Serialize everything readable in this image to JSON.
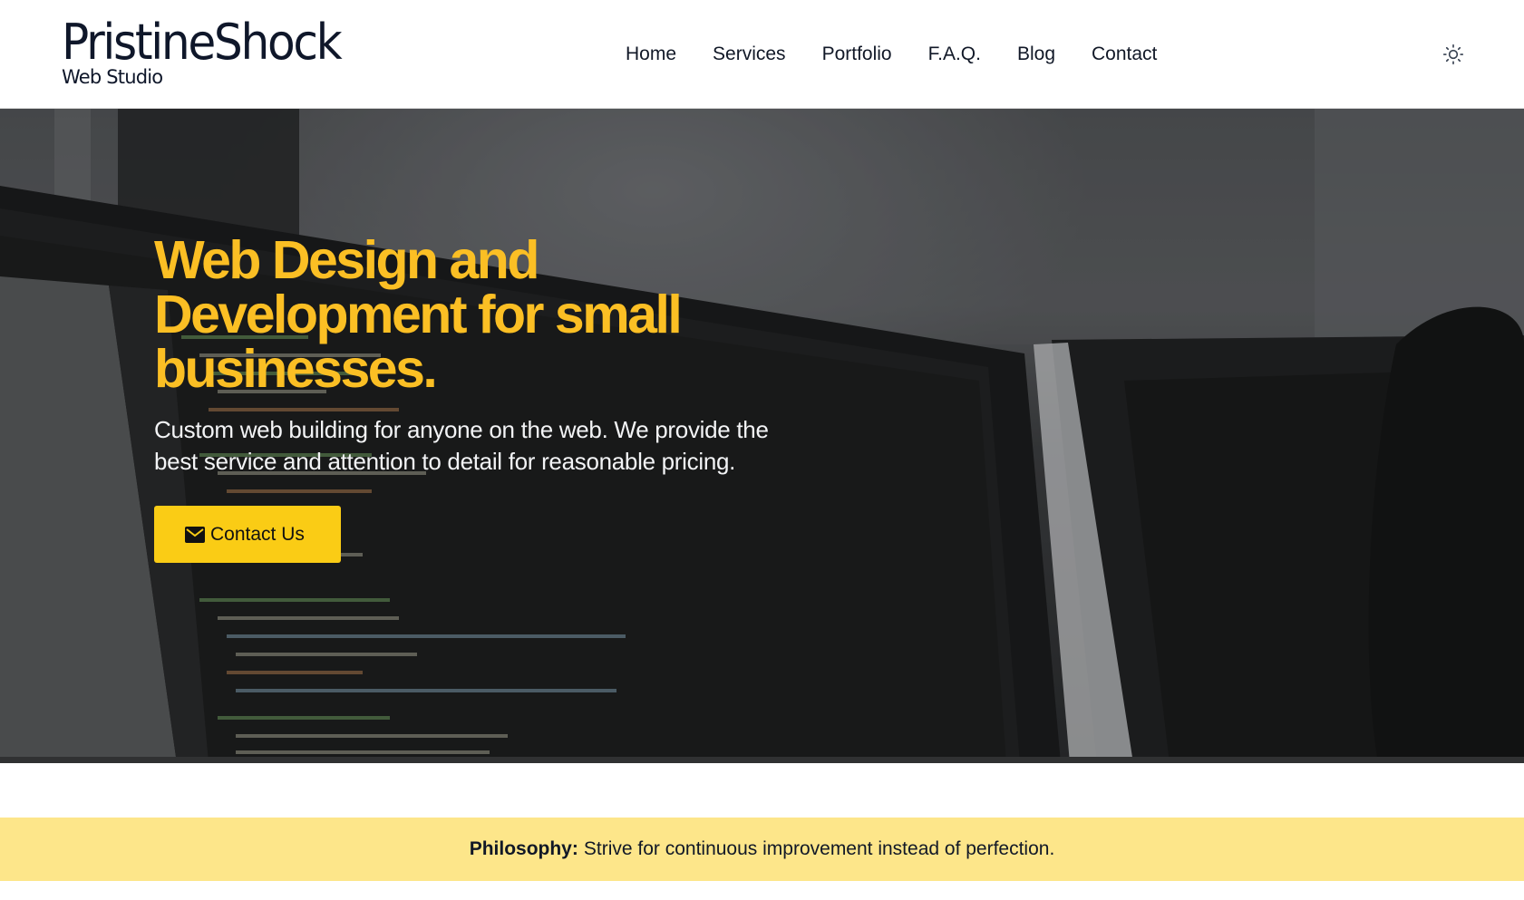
{
  "header": {
    "brand_name": "PristineShock",
    "brand_tagline": "Web Studio",
    "nav": [
      "Home",
      "Services",
      "Portfolio",
      "F.A.Q.",
      "Blog",
      "Contact"
    ],
    "theme_toggle_icon": "sun-icon"
  },
  "hero": {
    "title": "Web Design and Development for small businesses.",
    "subtitle": "Custom web building for anyone on the web. We provide the best service and attention to detail for reasonable pricing.",
    "cta_label": "Contact Us",
    "cta_icon": "mail-icon",
    "background": "photo of computer monitors showing code, darkened"
  },
  "philosophy": {
    "label": "Philosophy:",
    "text": "Strive for continuous improvement instead of perfection."
  },
  "colors": {
    "accent": "#facc15",
    "hero_title": "#fbbf24",
    "philosophy_bg": "#fde68a",
    "text_dark": "#111827"
  }
}
